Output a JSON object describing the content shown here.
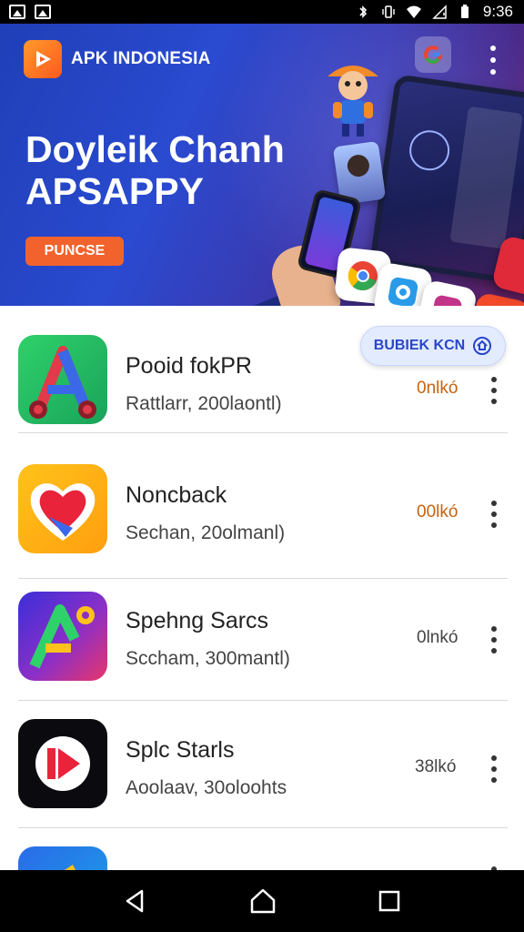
{
  "status_bar": {
    "time": "9:36",
    "left_icons": [
      "image-icon",
      "gallery-icon"
    ],
    "right_icons": [
      "bluetooth-icon",
      "vibrate-icon",
      "wifi-icon",
      "no-sim-icon",
      "battery-icon"
    ]
  },
  "banner": {
    "brand": "APK INDONESIA",
    "title_line1": "Doyleik Chanh",
    "title_line2": "APSAPPY",
    "cta": "PUNCSE",
    "colors": {
      "gradient_start": "#1f3fb8",
      "gradient_end": "#6a2060",
      "cta": "#f2622c",
      "brand_logo": "#ff7a24"
    }
  },
  "apps": [
    {
      "name": "Pooid fokPR",
      "subtitle": "Rattlarr, 200laontl)",
      "meta": "0nlkó",
      "meta_color": "#c8620e",
      "icon": "a-letter-icon",
      "install_label": "BUBIEK KCN"
    },
    {
      "name": "Noncback",
      "subtitle": "Sechan, 20olmanl)",
      "meta": "00lkó",
      "meta_color": "#c8620e",
      "icon": "heart-icon"
    },
    {
      "name": "Spehng Sarcs",
      "subtitle": "Sccham, 300mantl)",
      "meta": "0lnkó",
      "meta_color": "#444444",
      "icon": "a-star-icon"
    },
    {
      "name": "Splc Starls",
      "subtitle": "Aoolaav, 30oloohts",
      "meta": "38lkó",
      "meta_color": "#444444",
      "icon": "play-icon"
    }
  ],
  "nav": {
    "icons": [
      "back-icon",
      "home-icon",
      "recents-icon"
    ]
  }
}
